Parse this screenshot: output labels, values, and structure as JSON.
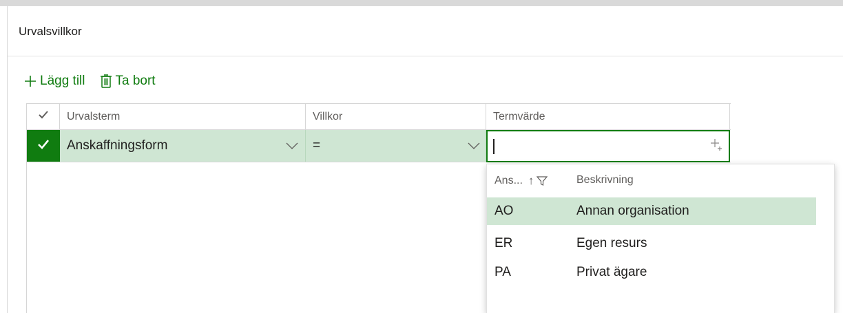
{
  "panel": {
    "title": "Urvalsvillkor"
  },
  "toolbar": {
    "add_label": "Lägg till",
    "remove_label": "Ta bort"
  },
  "grid": {
    "columns": [
      "Urvalsterm",
      "Villkor",
      "Termvärde"
    ],
    "row": {
      "term": "Anskaffningsform",
      "condition": "=",
      "value": ""
    }
  },
  "dropdown": {
    "header_code": "Ans...",
    "header_desc": "Beskrivning",
    "sort_glyph": "↑",
    "items": [
      {
        "code": "AO",
        "desc": "Annan organisation"
      },
      {
        "code": "ER",
        "desc": "Egen resurs"
      },
      {
        "code": "PA",
        "desc": "Privat ägare"
      }
    ],
    "selected_index": 0
  },
  "colors": {
    "accent": "#107c10",
    "selected_row": "#cfe6d3",
    "border": "#d6d6d6"
  },
  "icons": {
    "add": "plus-icon",
    "remove": "trash-icon",
    "check": "checkmark-icon",
    "chevron": "chevron-down-icon",
    "lookup": "lookup-plus-icon",
    "sort": "sort-ascending-icon",
    "filter": "filter-icon"
  }
}
